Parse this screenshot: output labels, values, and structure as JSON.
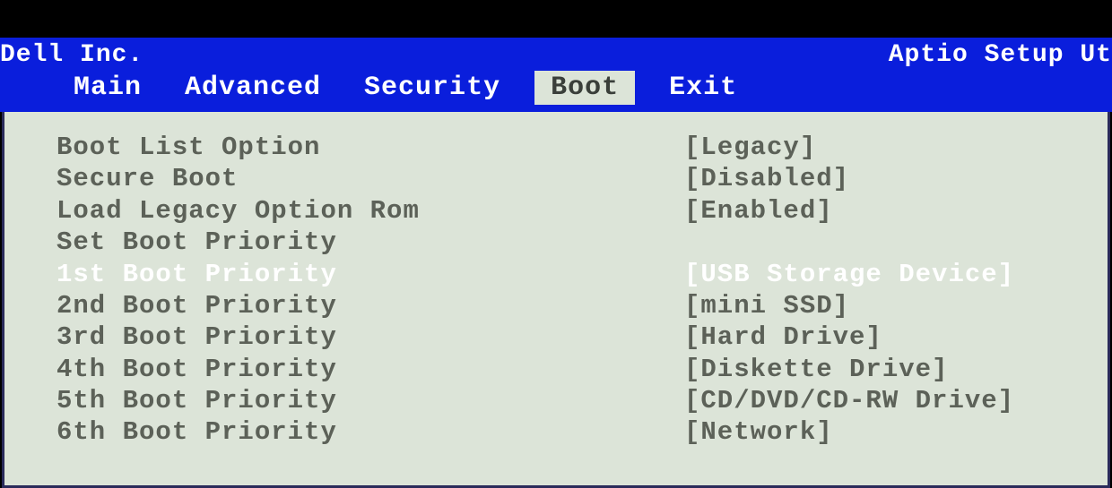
{
  "header": {
    "vendor": "Dell Inc.",
    "utility": "Aptio Setup Ut"
  },
  "tabs": [
    {
      "label": "Main",
      "active": false
    },
    {
      "label": "Advanced",
      "active": false
    },
    {
      "label": "Security",
      "active": false
    },
    {
      "label": "Boot",
      "active": true
    },
    {
      "label": "Exit",
      "active": false
    }
  ],
  "settings": [
    {
      "label": "Boot List Option",
      "value": "[Legacy]",
      "highlighted": false
    },
    {
      "label": "Secure Boot",
      "value": "[Disabled]",
      "highlighted": false
    },
    {
      "label": "Load Legacy Option Rom",
      "value": "[Enabled]",
      "highlighted": false
    },
    {
      "label": "Set Boot Priority",
      "value": "",
      "highlighted": false
    },
    {
      "label": "1st Boot Priority",
      "value": "[USB Storage Device]",
      "highlighted": true
    },
    {
      "label": "2nd Boot Priority",
      "value": "[mini SSD]",
      "highlighted": false
    },
    {
      "label": "3rd Boot Priority",
      "value": "[Hard Drive]",
      "highlighted": false
    },
    {
      "label": "4th Boot Priority",
      "value": "[Diskette Drive]",
      "highlighted": false
    },
    {
      "label": "5th Boot Priority",
      "value": "[CD/DVD/CD-RW Drive]",
      "highlighted": false
    },
    {
      "label": "6th Boot Priority",
      "value": "[Network]",
      "highlighted": false
    }
  ]
}
